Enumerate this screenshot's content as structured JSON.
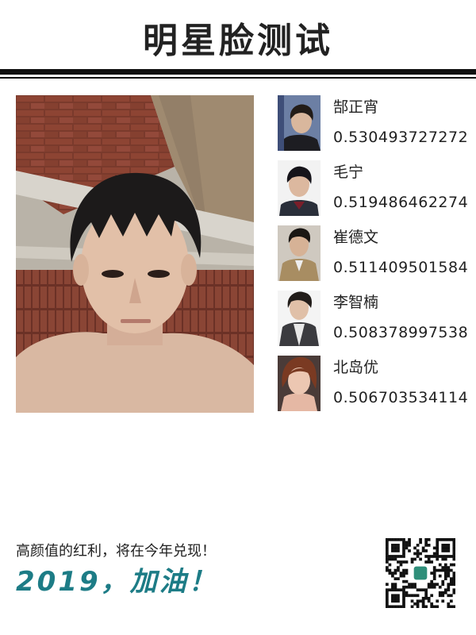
{
  "header": {
    "title": "明星脸测试"
  },
  "results": [
    {
      "name": "郜正宵",
      "score": "0.530493727272",
      "portrait": "singer-portrait"
    },
    {
      "name": "毛宁",
      "score": "0.519486462274",
      "portrait": "singer-portrait"
    },
    {
      "name": "崔德文",
      "score": "0.511409501584",
      "portrait": "actor-portrait"
    },
    {
      "name": "李智楠",
      "score": "0.508378997538",
      "portrait": "singer-portrait"
    },
    {
      "name": "北岛优",
      "score": "0.506703534114",
      "portrait": "actress-portrait"
    }
  ],
  "footer": {
    "slogan": "高颜值的红利，将在今年兑现！",
    "cheer": "2019，加油！"
  },
  "colors": {
    "accent": "#1d7c86",
    "text": "#222222",
    "rule": "#111111"
  }
}
